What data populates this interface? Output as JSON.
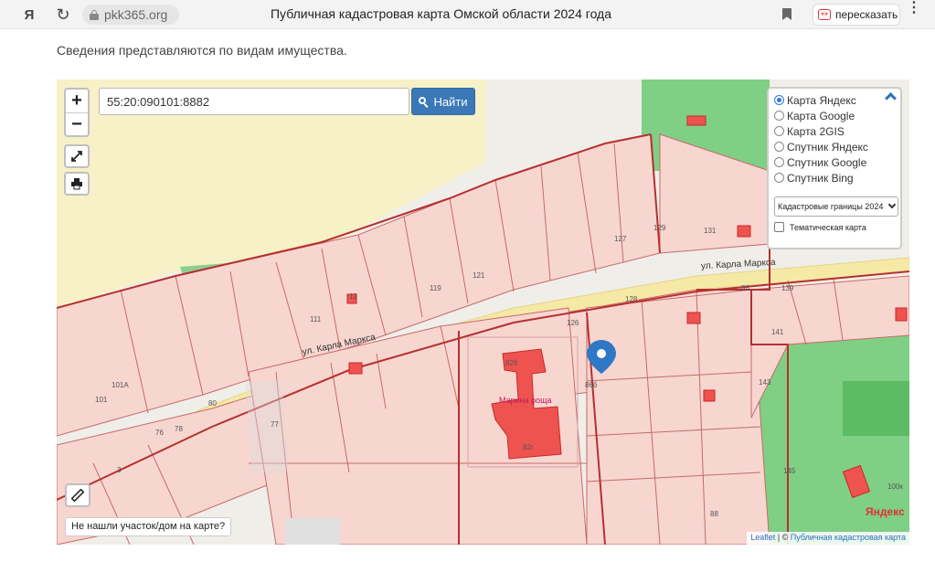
{
  "browser": {
    "address": "pkk365.org",
    "title": "Публичная кадастровая карта Омской области 2024 года",
    "retell_label": "пересказать",
    "retell_badge": "«»",
    "yandex_logo": "Я",
    "refresh_icon": "↻",
    "kebab": "⋮"
  },
  "page": {
    "intro": "Сведения представляются по видам имущества."
  },
  "map": {
    "search_value": "55:20:090101:8882",
    "find_label": "Найти",
    "zoom_in": "+",
    "zoom_out": "−",
    "not_found": "Не нашли участок/дом на карте?",
    "layers": {
      "options": [
        {
          "label": "Карта Яндекс",
          "selected": true
        },
        {
          "label": "Карта Google",
          "selected": false
        },
        {
          "label": "Карта 2GIS",
          "selected": false
        },
        {
          "label": "Спутник Яндекс",
          "selected": false
        },
        {
          "label": "Спутник Google",
          "selected": false
        },
        {
          "label": "Спутник Bing",
          "selected": false
        }
      ],
      "select_value": "Кадастровые границы 2024",
      "thematic_label": "Тематическая карта",
      "thematic_checked": false
    },
    "attribution": {
      "leaflet": "Leaflet",
      "sep": " | © ",
      "source": "Публичная кадастровая карта"
    },
    "yandex_watermark": "Яндекс",
    "street_label_1": "ул. Карла Маркса",
    "street_label_2": "ул. Карла Маркса",
    "poi_name": "Марина роща",
    "plot_numbers": [
      "82б",
      "82г",
      "86б",
      "86",
      "139",
      "141",
      "143",
      "145",
      "131",
      "129",
      "127",
      "121",
      "119",
      "111",
      "101",
      "101А",
      "76",
      "78",
      "80",
      "77",
      "3",
      "12",
      "126",
      "128",
      "88",
      "100к"
    ]
  },
  "colors": {
    "accent": "#3a78b7",
    "parcel_fill": "#f7d6d0",
    "parcel_border": "#c04a4a",
    "building": "#ef5350",
    "park": "#8bcf8e",
    "road": "#f6e9a6"
  }
}
